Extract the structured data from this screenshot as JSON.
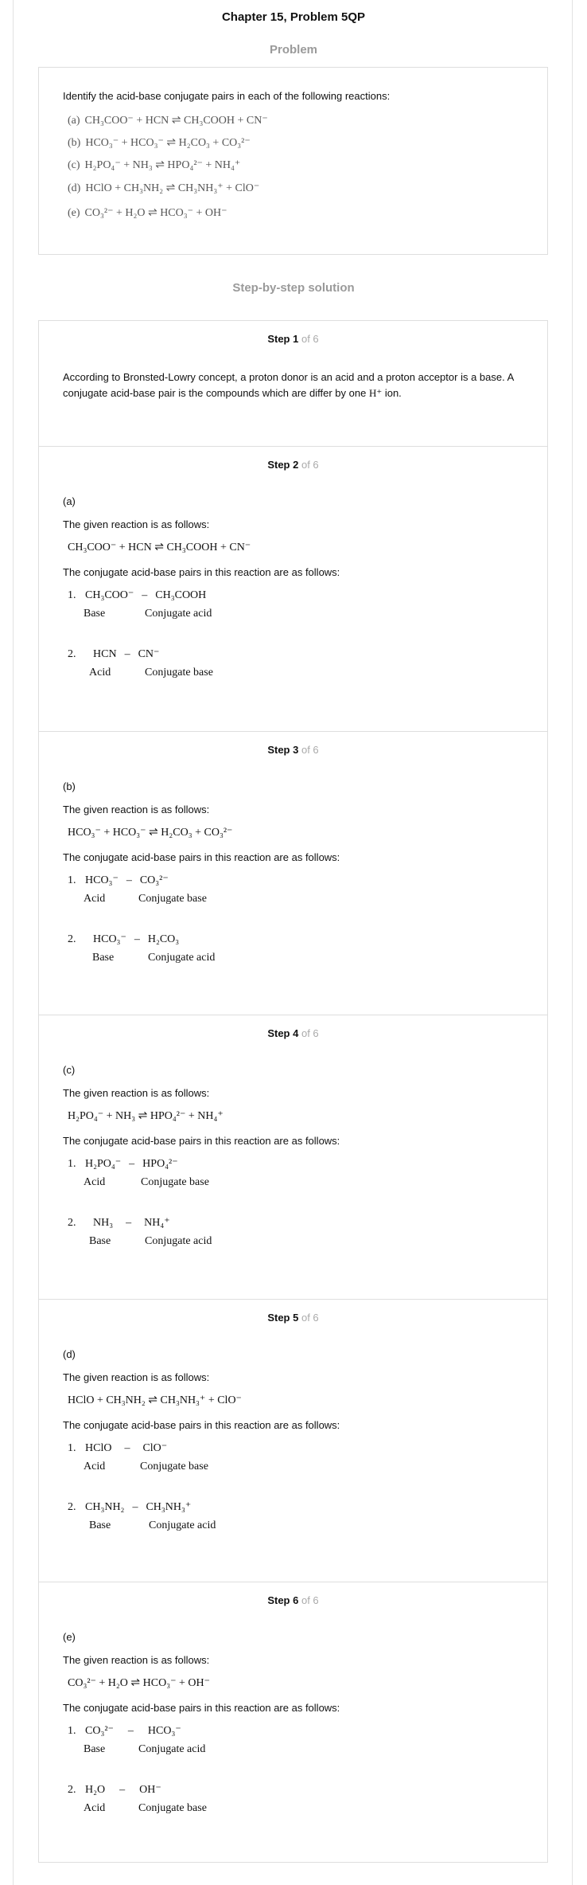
{
  "header": {
    "title": "Chapter 15, Problem 5QP"
  },
  "problem": {
    "heading": "Problem",
    "intro": "Identify the acid-base conjugate pairs in each of the following reactions:",
    "reactions": [
      {
        "label": "(a)",
        "equation": "CH₃COO⁻ + HCN ⇌ CH₃COOH + CN⁻"
      },
      {
        "label": "(b)",
        "equation": "HCO₃⁻ + HCO₃⁻ ⇌ H₂CO₃ + CO₃²⁻"
      },
      {
        "label": "(c)",
        "equation": "H₂PO₄⁻ + NH₃ ⇌ HPO₄²⁻ + NH₄⁺"
      },
      {
        "label": "(d)",
        "equation": "HClO + CH₃NH₂ ⇌ CH₃NH₃⁺ + ClO⁻"
      },
      {
        "label": "(e)",
        "equation": "CO₃²⁻ + H₂O ⇌ HCO₃⁻ + OH⁻"
      }
    ]
  },
  "solution": {
    "heading": "Step-by-step solution",
    "of_label": "of 6",
    "steps": [
      {
        "title": "Step 1",
        "text": "According to Bronsted-Lowry concept, a proton donor is an acid and a proton acceptor is a base. A conjugate acid-base pair is the compounds which are differ by one",
        "ion": "H⁺",
        "text_end": "ion."
      },
      {
        "title": "Step 2",
        "part": "(a)",
        "given": "The given reaction is as follows:",
        "equation": "CH₃COO⁻ + HCN ⇌ CH₃COOH + CN⁻",
        "pairs_intro": "The conjugate acid-base pairs in this reaction are as follows:",
        "pairs": [
          {
            "n": "1.",
            "left": "CH₃COO⁻",
            "right": "CH₃COOH",
            "left_role": "Base",
            "right_role": "Conjugate acid"
          },
          {
            "n": "2.",
            "left": "HCN",
            "right": "CN⁻",
            "left_role": "Acid",
            "right_role": "Conjugate base"
          }
        ]
      },
      {
        "title": "Step 3",
        "part": "(b)",
        "given": "The given reaction is as follows:",
        "equation": "HCO₃⁻ + HCO₃⁻ ⇌ H₂CO₃ + CO₃²⁻",
        "pairs_intro": "The conjugate acid-base pairs in this reaction are as follows:",
        "pairs": [
          {
            "n": "1.",
            "left": "HCO₃⁻",
            "right": "CO₃²⁻",
            "left_role": "Acid",
            "right_role": "Conjugate base"
          },
          {
            "n": "2.",
            "left": "HCO₃⁻",
            "right": "H₂CO₃",
            "left_role": "Base",
            "right_role": "Conjugate acid"
          }
        ]
      },
      {
        "title": "Step 4",
        "part": "(c)",
        "given": "The given reaction is as follows:",
        "equation": "H₂PO₄⁻ + NH₃ ⇌ HPO₄²⁻ + NH₄⁺",
        "pairs_intro": "The conjugate acid-base pairs in this reaction are as follows:",
        "pairs": [
          {
            "n": "1.",
            "left": "H₂PO₄⁻",
            "right": "HPO₄²⁻",
            "left_role": "Acid",
            "right_role": "Conjugate base"
          },
          {
            "n": "2.",
            "left": "NH₃",
            "right": "NH₄⁺",
            "left_role": "Base",
            "right_role": "Conjugate acid"
          }
        ]
      },
      {
        "title": "Step 5",
        "part": "(d)",
        "given": "The given reaction is as follows:",
        "equation": "HClO + CH₃NH₂ ⇌ CH₃NH₃⁺ + ClO⁻",
        "pairs_intro": "The conjugate acid-base pairs in this reaction are as follows:",
        "pairs": [
          {
            "n": "1.",
            "left": "HClO",
            "right": "ClO⁻",
            "left_role": "Acid",
            "right_role": "Conjugate base"
          },
          {
            "n": "2.",
            "left": "CH₃NH₂",
            "right": "CH₃NH₃⁺",
            "left_role": "Base",
            "right_role": "Conjugate acid"
          }
        ]
      },
      {
        "title": "Step 6",
        "part": "(e)",
        "given": "The given reaction is as follows:",
        "equation": "CO₃²⁻ + H₂O ⇌ HCO₃⁻ + OH⁻",
        "pairs_intro": "The conjugate acid-base pairs in this reaction are as follows:",
        "pairs": [
          {
            "n": "1.",
            "left": "CO₃²⁻",
            "right": "HCO₃⁻",
            "left_role": "Base",
            "right_role": "Conjugate acid"
          },
          {
            "n": "2.",
            "left": "H₂O",
            "right": "OH⁻",
            "left_role": "Acid",
            "right_role": "Conjugate base"
          }
        ]
      }
    ]
  }
}
